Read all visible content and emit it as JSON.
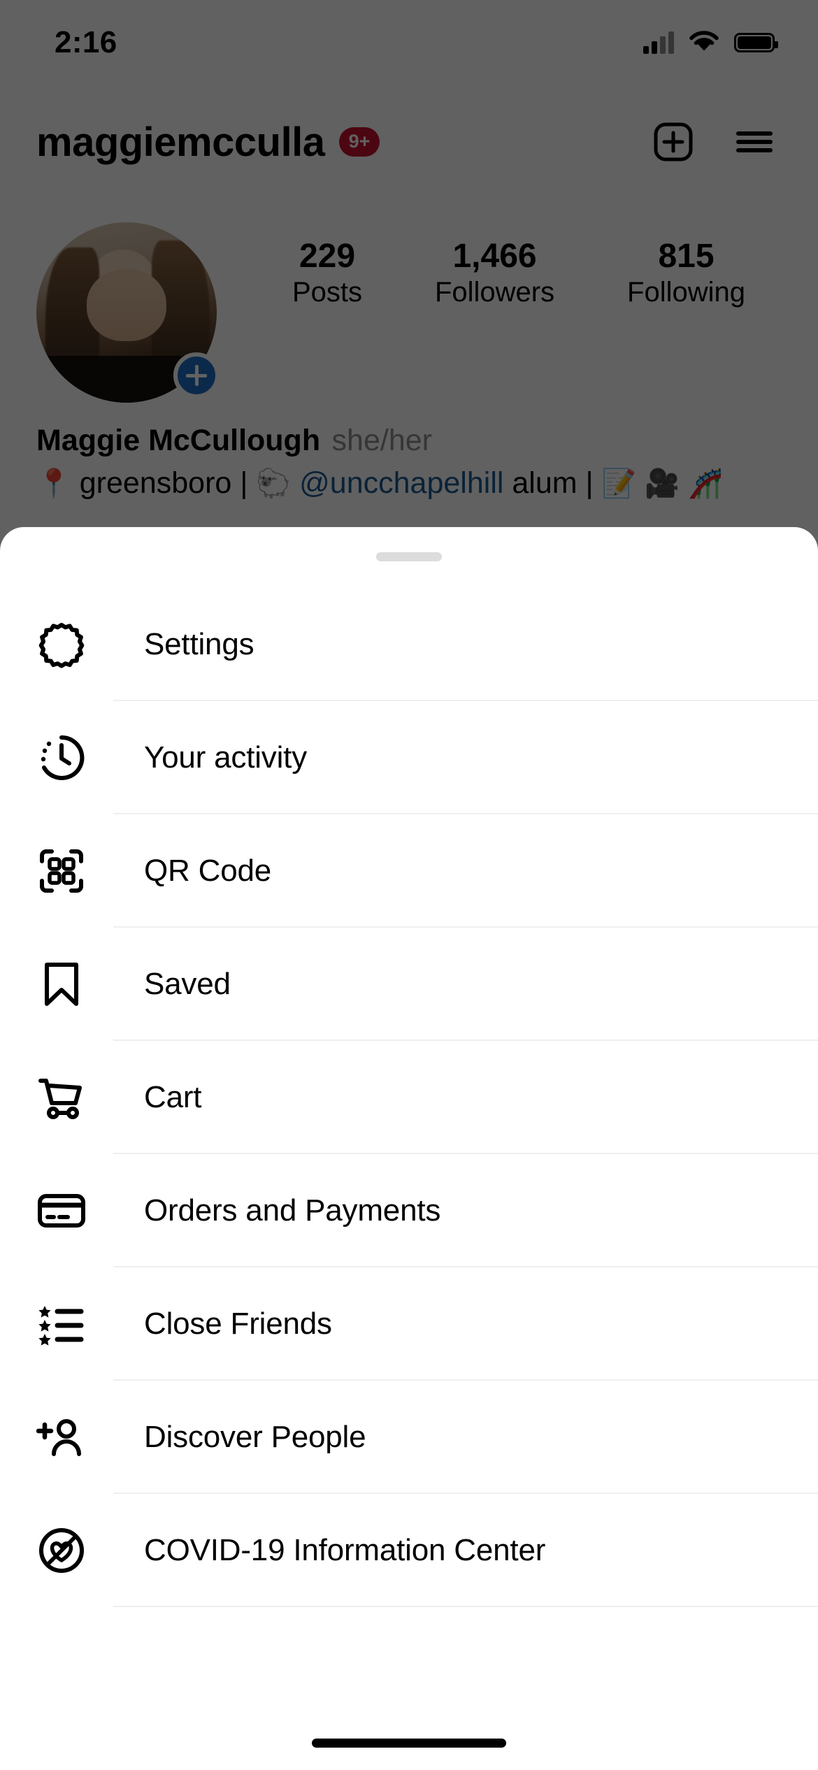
{
  "status_bar": {
    "time": "2:16",
    "signal_icon": "cellular-signal-icon",
    "wifi_icon": "wifi-icon",
    "battery_icon": "battery-icon"
  },
  "profile": {
    "username": "maggiemcculla",
    "notification_badge": "9+",
    "add_post_icon": "plus-square-icon",
    "menu_icon": "hamburger-menu-icon",
    "avatar_icon": "profile-avatar",
    "avatar_add_icon": "add-story-plus-icon",
    "stats": [
      {
        "value": "229",
        "label": "Posts"
      },
      {
        "value": "1,466",
        "label": "Followers"
      },
      {
        "value": "815",
        "label": "Following"
      }
    ],
    "bio": {
      "name": "Maggie McCullough",
      "pronouns": "she/her",
      "location_emoji": "📍",
      "location": "greensboro",
      "separator_1": "|",
      "school_emoji": "🐑",
      "handle": "@uncchapelhill",
      "handle_suffix": "alum",
      "separator_2": "|",
      "emoji_1": "📝",
      "emoji_2": "🎥",
      "emoji_3": "🎢"
    }
  },
  "sheet": {
    "grabber": "sheet-drag-handle",
    "items": [
      {
        "label": "Settings",
        "icon": "gear-icon"
      },
      {
        "label": "Your activity",
        "icon": "clock-activity-icon"
      },
      {
        "label": "QR Code",
        "icon": "qr-code-icon"
      },
      {
        "label": "Saved",
        "icon": "bookmark-icon"
      },
      {
        "label": "Cart",
        "icon": "shopping-cart-icon"
      },
      {
        "label": "Orders and Payments",
        "icon": "credit-card-icon"
      },
      {
        "label": "Close Friends",
        "icon": "star-list-icon"
      },
      {
        "label": "Discover People",
        "icon": "person-plus-icon"
      },
      {
        "label": "COVID-19 Information Center",
        "icon": "heart-circle-icon"
      }
    ]
  },
  "system": {
    "home_indicator": "home-indicator"
  },
  "colors": {
    "badge_red": "#c8102e",
    "link_blue": "#1b5a90",
    "story_plus_blue": "#1d6fc4",
    "muted_gray": "#8e8e8e",
    "divider": "#efefef"
  }
}
